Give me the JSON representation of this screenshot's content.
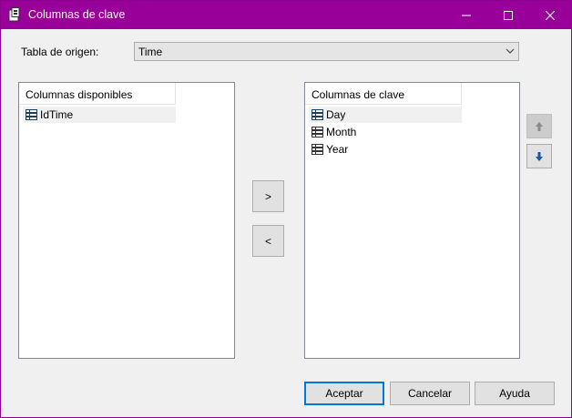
{
  "window": {
    "title": "Columnas de clave",
    "accent_color": "#990099",
    "icon": "dialog-app-icon"
  },
  "titlebar_buttons": {
    "minimize_icon": "minimize-icon",
    "maximize_icon": "maximize-icon",
    "close_icon": "close-icon"
  },
  "source": {
    "label": "Tabla de origen:",
    "selected": "Time"
  },
  "available": {
    "header": "Columnas disponibles",
    "items": [
      {
        "label": "IdTime",
        "icon": "column-icon"
      }
    ]
  },
  "key": {
    "header": "Columnas de clave",
    "items": [
      {
        "label": "Day",
        "icon": "column-icon"
      },
      {
        "label": "Month",
        "icon": "column-icon"
      },
      {
        "label": "Year",
        "icon": "column-icon"
      }
    ]
  },
  "move": {
    "add_label": ">",
    "remove_label": "<"
  },
  "order": {
    "up_icon": "arrow-up-icon",
    "down_icon": "arrow-down-icon"
  },
  "buttons": {
    "ok": "Aceptar",
    "cancel": "Cancelar",
    "help": "Ayuda"
  }
}
